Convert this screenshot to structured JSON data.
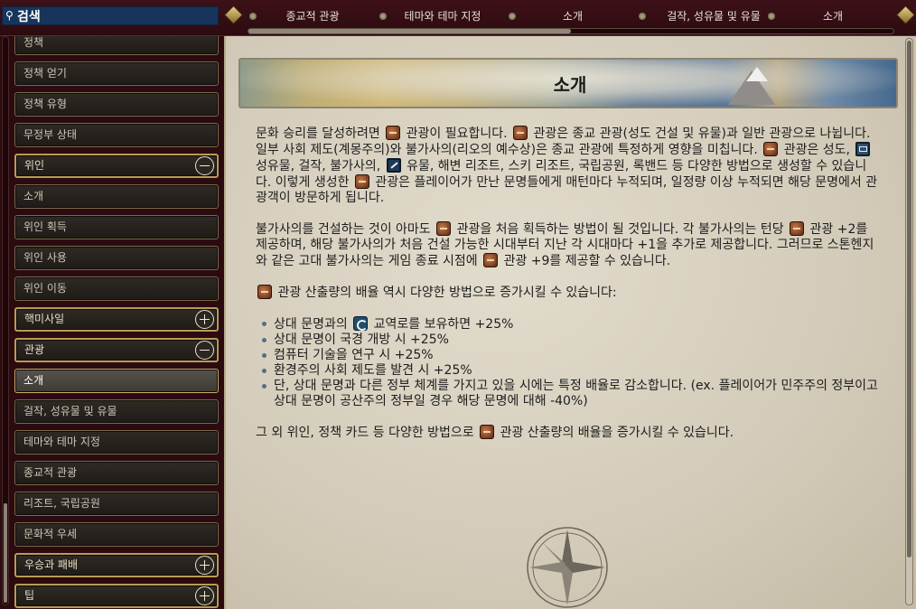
{
  "search": {
    "placeholder": "검색"
  },
  "breadcrumbs": [
    {
      "label": "종교적 관광"
    },
    {
      "label": "테마와 테마 지정"
    },
    {
      "label": "소개"
    },
    {
      "label": "걸작, 성유물 및 유물"
    },
    {
      "label": "소개"
    }
  ],
  "sidebar": {
    "items": [
      {
        "label": "정책",
        "kind": "item"
      },
      {
        "label": "정책 얻기",
        "kind": "item"
      },
      {
        "label": "정책 유형",
        "kind": "item"
      },
      {
        "label": "무정부 상태",
        "kind": "item"
      },
      {
        "label": "위인",
        "kind": "category",
        "state": "expanded"
      },
      {
        "label": "소개",
        "kind": "item"
      },
      {
        "label": "위인 획득",
        "kind": "item"
      },
      {
        "label": "위인 사용",
        "kind": "item"
      },
      {
        "label": "위인 이동",
        "kind": "item"
      },
      {
        "label": "핵미사일",
        "kind": "category",
        "state": "collapsed"
      },
      {
        "label": "관광",
        "kind": "category",
        "state": "expanded"
      },
      {
        "label": "소개",
        "kind": "item",
        "selected": true
      },
      {
        "label": "걸작, 성유물 및 유물",
        "kind": "item"
      },
      {
        "label": "테마와 테마 지정",
        "kind": "item"
      },
      {
        "label": "종교적 관광",
        "kind": "item"
      },
      {
        "label": "리조트, 국립공원",
        "kind": "item"
      },
      {
        "label": "문화적 우세",
        "kind": "item"
      },
      {
        "label": "우승과 패배",
        "kind": "category",
        "state": "collapsed"
      },
      {
        "label": "팁",
        "kind": "category",
        "state": "collapsed"
      }
    ]
  },
  "article": {
    "title": "소개",
    "p1": [
      "문화 승리를 달성하려면 ",
      {
        "icon": "tourism-icon"
      },
      " 관광이 필요합니다. ",
      {
        "icon": "tourism-icon"
      },
      " 관광은 종교 관광(성도 건설 및 유물)과 일반 관광으로 나뉩니다. 일부 사회 제도(계몽주의)와 불가사의(리오의 예수상)은 종교 관광에 특정하게 영향을 미칩니다. ",
      {
        "icon": "tourism-icon"
      },
      " 관광은 성도, ",
      {
        "icon": "great-work-icon"
      },
      " 성유물, 걸작, 불가사의, ",
      {
        "icon": "artifact-icon"
      },
      " 유물, 해변 리조트, 스키 리조트, 국립공원, 록밴드 등 다양한 방법으로 생성할 수 있습니다. 이렇게 생성한 ",
      {
        "icon": "tourism-icon"
      },
      " 관광은 플레이어가 만난 문명들에게 매턴마다 누적되며, 일정량 이상 누적되면 해당 문명에서 관광객이 방문하게 됩니다."
    ],
    "p2": [
      "불가사의를 건설하는 것이 아마도 ",
      {
        "icon": "tourism-icon"
      },
      " 관광을 처음 획득하는 방법이 될 것입니다. 각 불가사의는 턴당 ",
      {
        "icon": "tourism-icon"
      },
      " 관광 +2를 제공하며, 해당 불가사의가 처음 건설 가능한 시대부터 지난 각 시대마다 +1을 추가로 제공합니다. 그러므로 스톤헨지와 같은 고대 불가사의는 게임 종료 시점에 ",
      {
        "icon": "tourism-icon"
      },
      " 관광 +9를 제공할 수 있습니다."
    ],
    "p3": [
      {
        "icon": "tourism-icon"
      },
      " 관광 산출량의 배율 역시 다양한 방법으로 증가시킬 수 있습니다:"
    ],
    "bullets": [
      [
        "상대 문명과의 ",
        {
          "icon": "trade-route-icon"
        },
        " 교역로를 보유하면 +25%"
      ],
      [
        "상대 문명이 국경 개방 시 +25%"
      ],
      [
        "컴퓨터 기술을 연구 시 +25%"
      ],
      [
        "환경주의 사회 제도를 발견 시 +25%"
      ],
      [
        "단, 상대 문명과 다른 정부 체계를 가지고 있을 시에는 특정 배율로 감소합니다. (ex. 플레이어가 민주주의 정부이고 상대 문명이 공산주의 정부일 경우 해당 문명에 대해 -40%)"
      ]
    ],
    "p4": [
      "그 외 위인, 정책 카드 등 다양한 방법으로 ",
      {
        "icon": "tourism-icon"
      },
      " 관광 산출량의 배율을 증가시킬 수 있습니다."
    ]
  }
}
